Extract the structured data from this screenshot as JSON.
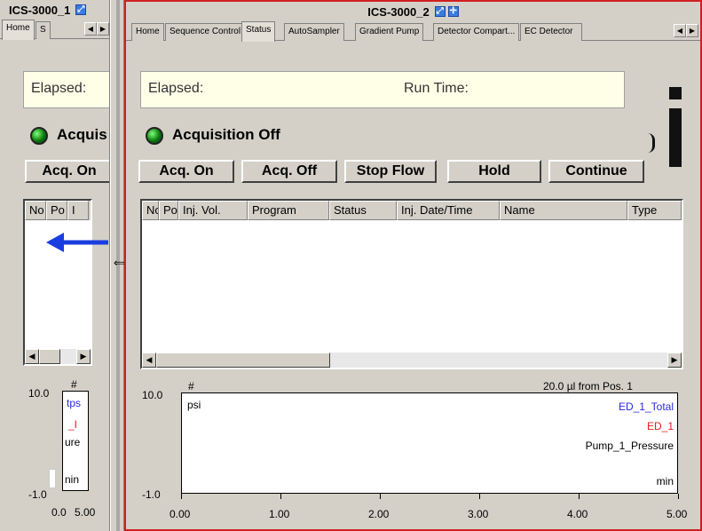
{
  "left_panel": {
    "title": "ICS-3000_1",
    "tabs": [
      "Home",
      "S"
    ],
    "elapsed_label": "Elapsed:",
    "acquisition_label": "Acquis",
    "acq_on_label": "Acq. On",
    "columns": [
      "No",
      "Po",
      "I"
    ],
    "chart": {
      "y_top": "10.0",
      "y_bottom": "-1.0",
      "hash": "#",
      "x_ticks": [
        "0.0",
        "5.00"
      ],
      "legend": [
        "tps",
        "_I",
        "ure",
        "nin"
      ]
    }
  },
  "right_panel": {
    "title": "ICS-3000_2",
    "tabs": [
      "Home",
      "Sequence Control",
      "Status",
      "AutoSampler",
      "Gradient Pump",
      "Detector Compart...",
      "EC Detector"
    ],
    "active_tab": "Status",
    "elapsed_label": "Elapsed:",
    "run_time_label": "Run Time:",
    "acquisition_status": "Acquisition Off",
    "buttons": [
      "Acq. On",
      "Acq. Off",
      "Stop Flow",
      "Hold",
      "Continue"
    ],
    "columns": [
      "No",
      "Po",
      "Inj. Vol.",
      "Program",
      "Status",
      "Inj. Date/Time",
      "Name",
      "Type"
    ],
    "chart": {
      "injection_info": "20.0 µl from Pos. 1",
      "y_top": "10.0",
      "y_bottom": "-1.0",
      "hash": "#",
      "y_unit": "psi",
      "x_unit": "min",
      "legend": [
        {
          "name": "ED_1_Total",
          "color": "#2a2ae0"
        },
        {
          "name": "ED_1",
          "color": "#e02020"
        },
        {
          "name": "Pump_1_Pressure",
          "color": "#000000"
        }
      ]
    }
  },
  "chart_data": {
    "type": "line",
    "xlabel": "min",
    "ylabel": "psi",
    "xlim": [
      0,
      5
    ],
    "ylim": [
      -1.0,
      10.0
    ],
    "x_ticks": [
      "0.00",
      "1.00",
      "2.00",
      "3.00",
      "4.00",
      "5.00"
    ],
    "series": [
      {
        "name": "ED_1_Total",
        "values": []
      },
      {
        "name": "ED_1",
        "values": []
      },
      {
        "name": "Pump_1_Pressure",
        "values": []
      }
    ]
  },
  "colors": {
    "panel_bg": "#d4d0c8",
    "active_border": "#d02020",
    "drag_arrow": "#1a3de0",
    "led": "#1aa01a"
  },
  "icons": [
    "maximize-icon",
    "pin-icon",
    "drag-left-arrow-icon",
    "resize-cursor-icon"
  ]
}
